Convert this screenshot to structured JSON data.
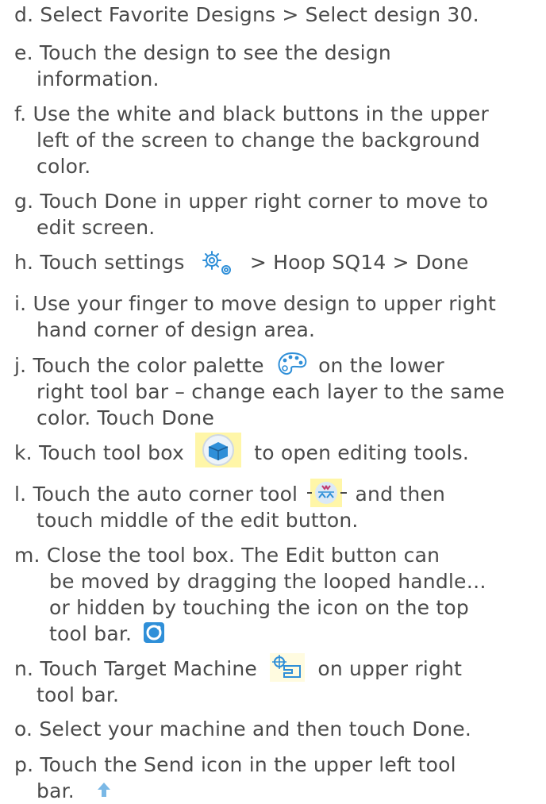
{
  "steps": [
    {
      "marker": "d.",
      "lines": [
        "Select Favorite Designs > Select design 30."
      ]
    },
    {
      "marker": "e.",
      "lines": [
        "Touch the design to see the design",
        "information."
      ]
    },
    {
      "marker": "f.",
      "lines": [
        "Use the white and black buttons in the upper",
        "left of the screen to change the background",
        "color."
      ]
    },
    {
      "marker": "g.",
      "lines": [
        "Touch Done in upper right corner to move to",
        "edit screen."
      ]
    },
    {
      "marker": "h.",
      "before_icon": "Touch settings",
      "after_icon": "> Hoop SQ14 > Done",
      "icon": "settings-gears-icon"
    },
    {
      "marker": "i.",
      "lines": [
        "Use your finger to move design to upper right",
        "hand corner of design area."
      ]
    },
    {
      "marker": "j.",
      "before_icon": "Touch the color palette",
      "after_icon": "on the lower",
      "icon": "color-palette-icon",
      "lines": [
        "right tool bar – change each layer to the same",
        "color. Touch Done"
      ]
    },
    {
      "marker": "k.",
      "before_icon": "Touch tool box",
      "after_icon": "to open editing tools.",
      "icon": "tool-box-icon"
    },
    {
      "marker": "l.",
      "before_icon": "Touch the auto corner tool",
      "after_icon": "and then",
      "icon": "auto-corner-tool-icon",
      "lines": [
        "touch middle of the edit button."
      ]
    },
    {
      "marker": "m.",
      "first": "Close the tool box. The Edit button can",
      "lines": [
        "be moved by dragging the looped handle…",
        "or hidden by touching the icon on the top"
      ],
      "last": "tool bar.",
      "icon": "edit-button-toggle-icon"
    },
    {
      "marker": "n.",
      "before_icon": "Touch Target Machine",
      "after_icon": "on upper right",
      "icon": "target-machine-icon",
      "lines": [
        "tool bar."
      ]
    },
    {
      "marker": "o.",
      "lines": [
        "Select your machine and then touch Done."
      ]
    },
    {
      "marker": "p.",
      "first": "Touch the Send icon in the upper left tool",
      "last": "bar.",
      "icon": "send-icon"
    }
  ],
  "colors": {
    "text": "#4a4a4a",
    "icon_blue": "#2f8fd8",
    "icon_highlight": "#fff6a8"
  }
}
